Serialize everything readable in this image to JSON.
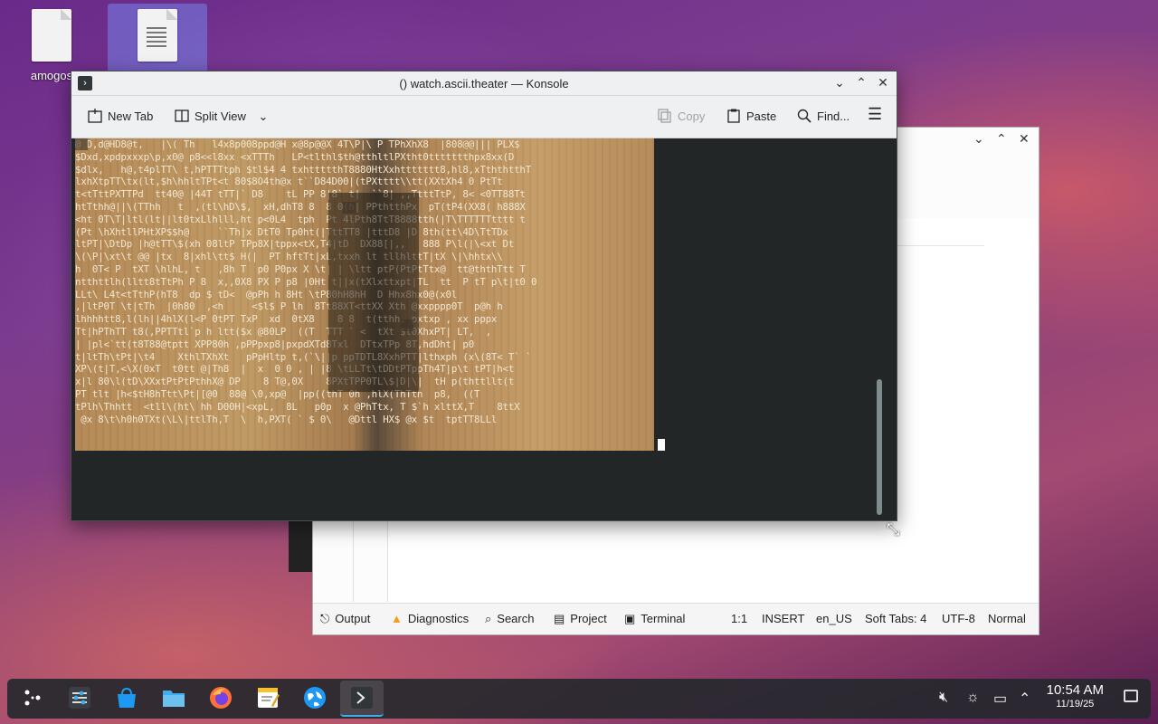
{
  "desktop": {
    "icons": [
      {
        "label": "amogos",
        "icon": "text-file-icon"
      },
      {
        "label": "",
        "icon": "text-file-icon"
      }
    ]
  },
  "kate": {
    "statusbar": {
      "output": "Output",
      "diagnostics": "Diagnostics",
      "search": "Search",
      "project": "Project",
      "terminal": "Terminal",
      "cursor_pos": "1:1",
      "mode": "INSERT",
      "language": "en_US",
      "tabs": "Soft Tabs: 4",
      "encoding": "UTF-8",
      "vi_mode": "Normal"
    }
  },
  "konsole": {
    "title": "() watch.ascii.theater — Konsole",
    "toolbar": {
      "new_tab": "New Tab",
      "split_view": "Split View",
      "copy": "Copy",
      "paste": "Paste",
      "find": "Find..."
    },
    "ascii_lines": [
      "@ D,d@HD8@t,   |\\( Th   l4x8p008ppd@H x@8p@@X 4T\\P|\\ P TPhXhX8  |808@@||| PLX$",
      "$Dxd,xpdpxxxp\\p,x0@ p8<<l8xx <xTTTh   LP<tlthl$th@tthltlPXtht0ttttttthpx8xx(D",
      "$dlx,   h@,t4plTT\\ t,hPTTTtph $tl$4 4 txhttttthT8880HtXxhttttttt8,hl8,xTththtthT",
      "lxhXtpTT\\tx(lt,$h\\hhltTPt<t 80$8O4th@x t``D84D00|(tPXtttt\\\\tt(XXtXh4 0 PtTt",
      "t<tTttPXTTPd  tt40@ |44T tTT|` D8    tL PP 8|8` t|  ``8| ,,TtttTtP, 8< <0TT88Tt",
      "htTthh@||\\(TThh   t  ,(tl\\hD\\$,  xH,dhT8 8  8 0(h| PPthtthPx  pT(tP4(XX8( h888X",
      "<ht 0T\\T|ltl(lt||lt0txLlhlll,ht p<0L4  tph  Pt 4lPth8TtT8888tth(|T\\TTTTTTtttt t",
      "(Pt \\hXhtllPHtXP$$h@     ``Th|x DtT0 Tp0ht(|TttTT8 |tttD8 |D 8th(tt\\4D\\TtTDx",
      "ltPT|\\DtDp |h@tTT\\$(xh 08ltP TPp8X|tppx<tX,T4|tD  DX88[|,,   888 P\\l(|\\<xt Dt",
      "\\(\\P|\\xt\\t @@ |tx  8|xhl\\tt$ H(|  PT hftTt|xL,txxh lt tllhlttT|tX \\|\\hhtx\\\\",
      "h  0T< P  tXT \\hlhL, t   ,8h T  p0 P0px X \\t| | \\ltt ptP(PtPtTtx@  tt@ththTtt T",
      "ntthttlh(lltt8tTtPh P 8  x,,0X8 PX P p8 |0Ht t||x(tXlxttxpt|TL  tt  P tT p\\t|t0 0",
      "LLt\\ L4t<tTthP(hT8  dp $ tD<  @pPh h 8Ht \\tP80hH8hH  D Hhx8hx0@(x0l",
      ",|ltP0T \\t|tTh  |0h80  ,<h     <$l$ P lh  8Tt88XT<ttXX Xth @xxpppp0T  p@h h",
      "lhhhhtt8,l(lh||4hlX(l<P 0tPT TxP  xd  0tX8    8 8  t(tthh, pxtxp , xx pppx",
      "Tt|hPThTT t8(,PPTTtl`p h ltt($x @80LP  ((T  TTT ` <  tXt $t0XhxPT| LT,  ,",
      "| |pl<`tt(t8T88@tptt XPP80h ,pPPpxp8|pxpdXTd8Txl  DTtxTPp 8T,hdDht| p0",
      "t|ltTh\\tPt|\\t4    XthlTXhXt   pPpHltp t,(`\\||p ppTDTL8XxhPTT|lthxph (x\\(8T< T` `",
      "XP\\(t|T,<\\X(0xT  t0tt @|Th8  |  x  0 0 , | |8 \\tLLTt\\tDDtPTppTh4T|p\\t tPT|h<t",
      "x|l 80\\l(tD\\XXxtPtPtPthhX@ DP    8 T@,0X    8PXtTPP0TL\\$|D|\\|  tH p(thttllt(t",
      "PT tlt |h<$tH8hTtt\\Pt|[@0  88@ \\0,xp@  |pp((thT 0h ,hlX(ThTth  p8,  ((T",
      "tPlh\\Thhtt  <tll\\(ht\\ hh D00H|<xpL,  8L   p0p  x @PhTtx, T $`h xlttX,T    8ttX",
      " @x 8\\t\\h0h0TXt(\\L\\|ttlTh,T  \\  h,PXT( ` $ 0\\   @Dttl HX$ @x $t  tptTT8LLl"
    ]
  },
  "taskbar": {
    "apps": [
      {
        "name": "application-launcher",
        "icon": "kde-launcher-icon"
      },
      {
        "name": "system-settings",
        "icon": "settings-icon"
      },
      {
        "name": "discover",
        "icon": "store-icon"
      },
      {
        "name": "dolphin",
        "icon": "folder-icon"
      },
      {
        "name": "firefox",
        "icon": "firefox-icon"
      },
      {
        "name": "kate",
        "icon": "text-editor-icon"
      },
      {
        "name": "browser",
        "icon": "globe-icon"
      },
      {
        "name": "konsole",
        "icon": "terminal-icon"
      }
    ],
    "clock": {
      "time": "10:54 AM",
      "date": "11/19/25"
    }
  }
}
